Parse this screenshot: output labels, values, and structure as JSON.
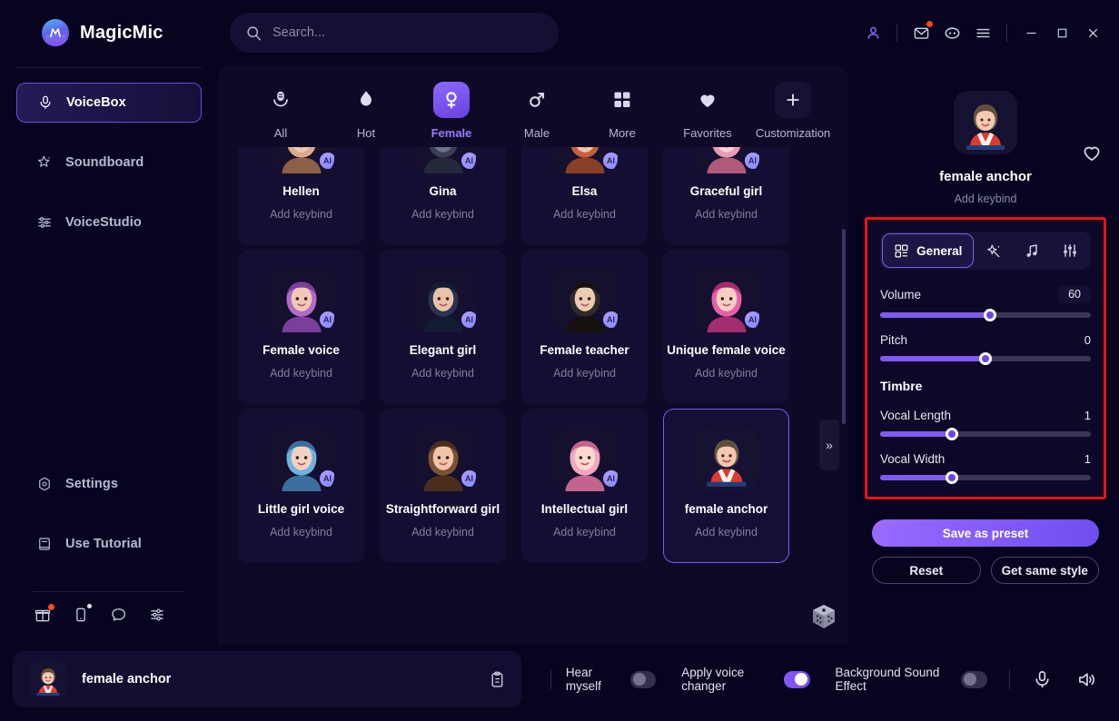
{
  "app": {
    "brand": "MagicMic",
    "logo_letter": "M"
  },
  "search": {
    "placeholder": "Search..."
  },
  "titlebar": {
    "icons": [
      "user-icon",
      "mail-icon",
      "discord-icon",
      "menu-icon"
    ],
    "minimize": "─",
    "maximize": "□",
    "close": "✕"
  },
  "sidebar": {
    "items": [
      {
        "label": "VoiceBox",
        "icon": "microphone-icon",
        "active": true
      },
      {
        "label": "Soundboard",
        "icon": "magic-star-icon",
        "active": false
      },
      {
        "label": "VoiceStudio",
        "icon": "equalizer-icon",
        "active": false
      }
    ],
    "bottom_items": [
      {
        "label": "Settings",
        "icon": "gear-icon"
      },
      {
        "label": "Use Tutorial",
        "icon": "book-icon"
      }
    ],
    "mini_icons": [
      "gift-icon",
      "mobile-icon",
      "chat-icon",
      "share-icon"
    ]
  },
  "categories": [
    {
      "label": "All",
      "icon": "mic-outline-icon",
      "active": false
    },
    {
      "label": "Hot",
      "icon": "flame-icon",
      "active": false
    },
    {
      "label": "Female",
      "icon": "female-symbol-icon",
      "active": true
    },
    {
      "label": "Male",
      "icon": "male-symbol-icon",
      "active": false
    },
    {
      "label": "More",
      "icon": "grid-icon",
      "active": false
    }
  ],
  "category_right": [
    {
      "label": "Favorites",
      "icon": "heart-icon"
    },
    {
      "label": "Customization",
      "icon": "plus-icon"
    }
  ],
  "voice_cards": [
    {
      "name": "Hellen",
      "keybind": "Add keybind",
      "ai": "AI",
      "selected": false
    },
    {
      "name": "Gina",
      "keybind": "Add keybind",
      "ai": "AI",
      "selected": false
    },
    {
      "name": "Elsa",
      "keybind": "Add keybind",
      "ai": "AI",
      "selected": false
    },
    {
      "name": "Graceful girl",
      "keybind": "Add keybind",
      "ai": "AI",
      "selected": false
    },
    {
      "name": "Female voice",
      "keybind": "Add keybind",
      "ai": "AI",
      "selected": false
    },
    {
      "name": "Elegant girl",
      "keybind": "Add keybind",
      "ai": "AI",
      "selected": false
    },
    {
      "name": "Female teacher",
      "keybind": "Add keybind",
      "ai": "AI",
      "selected": false
    },
    {
      "name": "Unique female voice",
      "keybind": "Add keybind",
      "ai": "AI",
      "selected": false
    },
    {
      "name": "Little girl voice",
      "keybind": "Add keybind",
      "ai": "AI",
      "selected": false
    },
    {
      "name": "Straightforward girl",
      "keybind": "Add keybind",
      "ai": "AI",
      "selected": false
    },
    {
      "name": "Intellectual girl",
      "keybind": "Add keybind",
      "ai": "AI",
      "selected": false
    },
    {
      "name": "female anchor",
      "keybind": "Add keybind",
      "ai": "",
      "selected": true
    }
  ],
  "grid_controls": {
    "expand": "»",
    "dice": "dice-icon"
  },
  "detail": {
    "title": "female anchor",
    "keybind": "Add keybind",
    "favorite_icon": "heart-outline-icon",
    "tabs": [
      {
        "label": "General",
        "icon": "general-grid-icon",
        "active": true
      },
      {
        "label": "",
        "icon": "magic-wand-icon",
        "active": false
      },
      {
        "label": "",
        "icon": "music-note-icon",
        "active": false
      },
      {
        "label": "",
        "icon": "sliders-icon",
        "active": false
      }
    ],
    "sliders": [
      {
        "label": "Volume",
        "value": "60",
        "percent": 52,
        "boxed": true
      },
      {
        "label": "Pitch",
        "value": "0",
        "percent": 50,
        "boxed": false
      }
    ],
    "timbre_label": "Timbre",
    "timbre_sliders": [
      {
        "label": "Vocal Length",
        "value": "1",
        "percent": 34,
        "boxed": false
      },
      {
        "label": "Vocal Width",
        "value": "1",
        "percent": 34,
        "boxed": false
      }
    ],
    "buttons": {
      "save": "Save as preset",
      "reset": "Reset",
      "same_style": "Get same style"
    },
    "highlight_color": "#ee1111"
  },
  "bottom": {
    "now_playing": "female anchor",
    "clipboard_icon": "clipboard-icon",
    "hear_myself": {
      "label": "Hear myself",
      "on": false
    },
    "apply_voice_changer": {
      "label": "Apply voice changer",
      "on": true
    },
    "background_sound": {
      "label": "Background Sound Effect",
      "on": false
    },
    "mic_icon": "microphone-icon",
    "speaker_icon": "speaker-icon"
  },
  "colors": {
    "accent": "#7a55ef",
    "panel": "#0d0926",
    "bg": "#07041f",
    "alert": "#ee1111"
  }
}
